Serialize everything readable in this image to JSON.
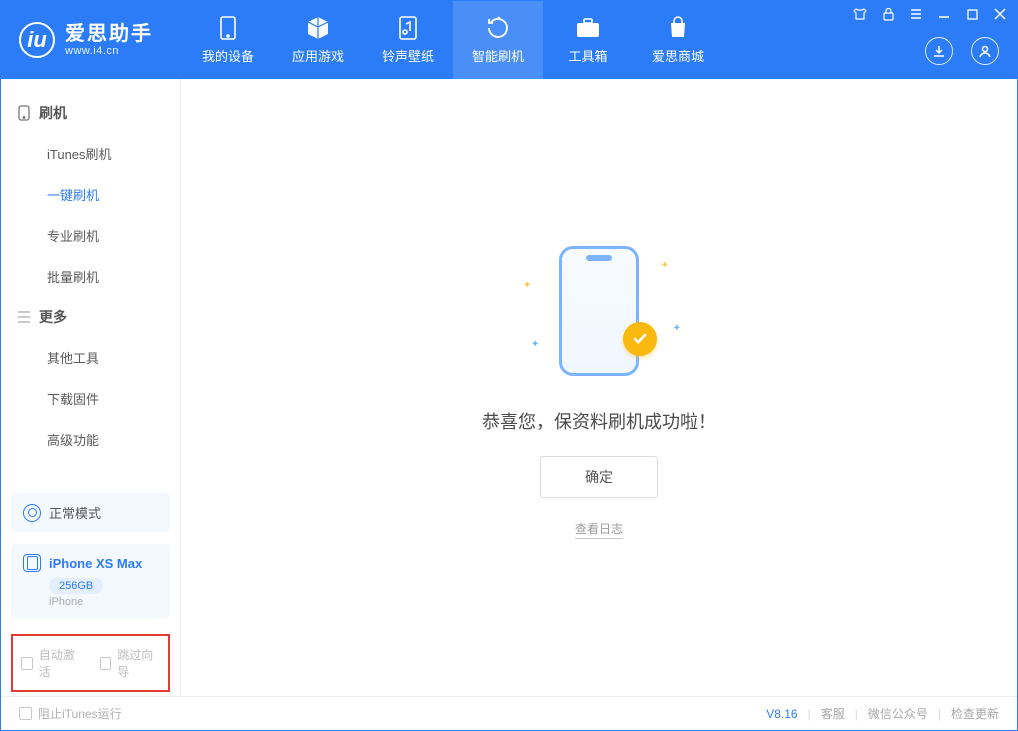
{
  "app": {
    "name": "爱思助手",
    "url": "www.i4.cn"
  },
  "nav": [
    {
      "label": "我的设备",
      "icon": "device-icon"
    },
    {
      "label": "应用游戏",
      "icon": "apps-icon"
    },
    {
      "label": "铃声壁纸",
      "icon": "ringtone-icon"
    },
    {
      "label": "智能刷机",
      "icon": "flash-icon",
      "active": true
    },
    {
      "label": "工具箱",
      "icon": "toolbox-icon"
    },
    {
      "label": "爱思商城",
      "icon": "store-icon"
    }
  ],
  "sidebar": {
    "groups": [
      {
        "title": "刷机",
        "icon": "phone-icon",
        "items": [
          "iTunes刷机",
          "一键刷机",
          "专业刷机",
          "批量刷机"
        ],
        "active_index": 1
      },
      {
        "title": "更多",
        "icon": "menu-icon",
        "items": [
          "其他工具",
          "下载固件",
          "高级功能"
        ],
        "active_index": -1
      }
    ],
    "mode": "正常模式",
    "device": {
      "name": "iPhone XS Max",
      "storage": "256GB",
      "type": "iPhone"
    },
    "highlight_checks": [
      "自动激活",
      "跳过向导"
    ]
  },
  "main": {
    "success_message": "恭喜您，保资料刷机成功啦！",
    "ok_button": "确定",
    "view_log": "查看日志"
  },
  "footer": {
    "block_itunes": "阻止iTunes运行",
    "version": "V8.16",
    "links": [
      "客服",
      "微信公众号",
      "检查更新"
    ]
  }
}
